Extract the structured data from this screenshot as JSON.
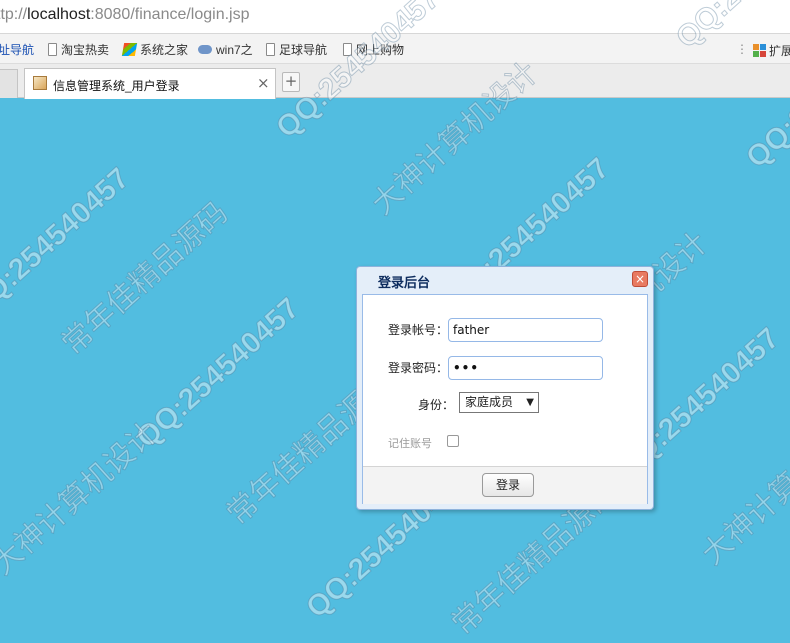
{
  "browser": {
    "url_prefix": "ttp://",
    "url_host": "localhost",
    "url_rest": ":8080/finance/login.jsp",
    "bookmarks": [
      {
        "label": "址导航",
        "icon": "none"
      },
      {
        "label": "淘宝热卖",
        "icon": "page-icon"
      },
      {
        "label": "系统之家",
        "icon": "windows-icon"
      },
      {
        "label": "win7之",
        "icon": "cloud-icon"
      },
      {
        "label": "足球导航",
        "icon": "page-icon"
      },
      {
        "label": "网上购物",
        "icon": "page-icon"
      }
    ],
    "extensions_label": "扩展",
    "tab_title": "信息管理系统_用户登录"
  },
  "watermarks": {
    "qq": "QQ:254540457",
    "brand_a": "大神计算机设计",
    "brand_b": "常年佳精品源码"
  },
  "login": {
    "title": "登录后台",
    "account_label": "登录帐号：",
    "account_value": "father",
    "password_label": "登录密码：",
    "password_value": "•••",
    "role_label": "身份：",
    "role_selected": "家庭成员",
    "remember_label": "记住账号",
    "remember_checked": false,
    "submit_label": "登录"
  },
  "colors": {
    "page_background": "#52bde0",
    "dialog_border": "#8fb3dc",
    "title_color": "#0e2d5f",
    "close_button": "#e87a61"
  }
}
